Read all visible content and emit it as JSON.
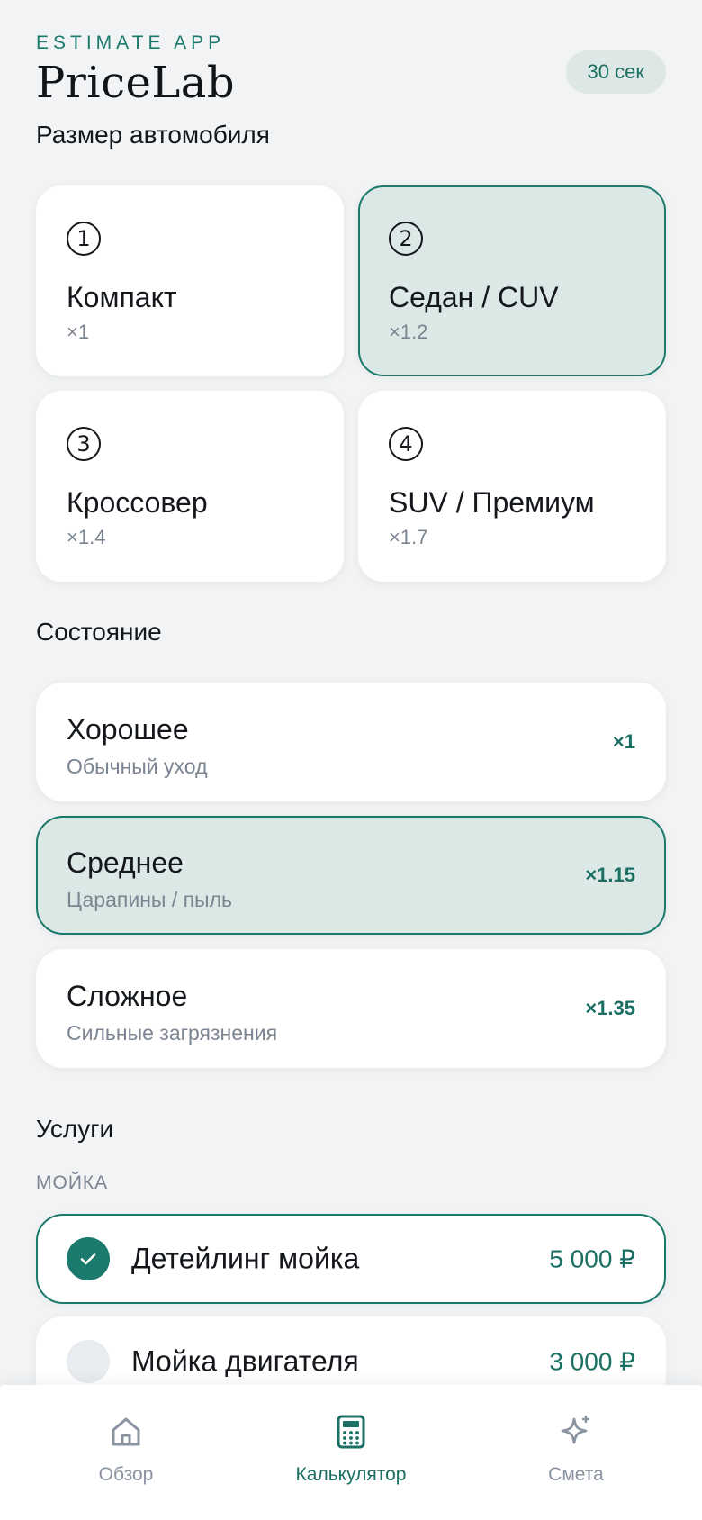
{
  "header": {
    "eyebrow": "ESTIMATE APP",
    "title": "PriceLab",
    "timer_badge": "30 сек"
  },
  "sections": {
    "size_title": "Размер автомобиля",
    "condition_title": "Состояние",
    "services_title": "Услуги"
  },
  "sizes": [
    {
      "num": "1",
      "name": "Компакт",
      "mult": "×1",
      "selected": false
    },
    {
      "num": "2",
      "name": "Седан / CUV",
      "mult": "×1.2",
      "selected": true
    },
    {
      "num": "3",
      "name": "Кроссовер",
      "mult": "×1.4",
      "selected": false
    },
    {
      "num": "4",
      "name": "SUV / Премиум",
      "mult": "×1.7",
      "selected": false
    }
  ],
  "conditions": [
    {
      "name": "Хорошее",
      "desc": "Обычный уход",
      "mult": "×1",
      "selected": false
    },
    {
      "name": "Среднее",
      "desc": "Царапины / пыль",
      "mult": "×1.15",
      "selected": true
    },
    {
      "name": "Сложное",
      "desc": "Сильные загрязнения",
      "mult": "×1.35",
      "selected": false
    }
  ],
  "services": {
    "group_label": "МОЙКА",
    "items": [
      {
        "name": "Детейлинг мойка",
        "price": "5 000 ₽",
        "checked": true
      },
      {
        "name": "Мойка двигателя",
        "price": "3 000 ₽",
        "checked": false
      }
    ]
  },
  "nav": {
    "items": [
      {
        "label": "Обзор",
        "icon": "home-icon",
        "active": false
      },
      {
        "label": "Калькулятор",
        "icon": "calculator-icon",
        "active": true
      },
      {
        "label": "Смета",
        "icon": "sparkle-icon",
        "active": false
      }
    ]
  },
  "colors": {
    "accent": "#1b7a6c",
    "selected_bg": "#dce8e6",
    "page_bg": "#f1f3f5",
    "muted_text": "#7b8491"
  }
}
